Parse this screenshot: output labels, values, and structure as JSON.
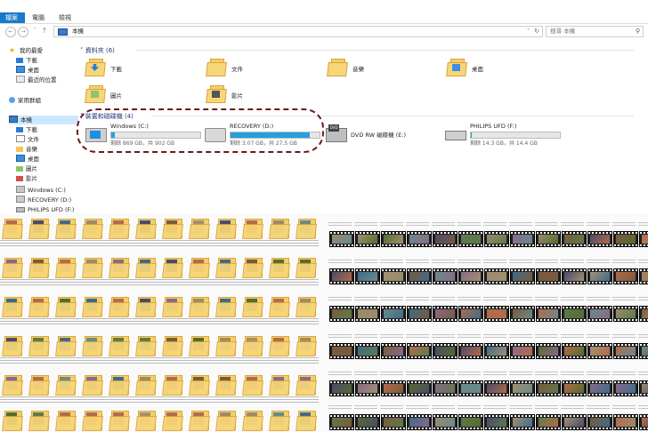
{
  "ribbon": {
    "tabs": [
      "檔案",
      "電腦",
      "檢視"
    ]
  },
  "address": {
    "crumb": "本機",
    "search_placeholder": "搜尋 本機"
  },
  "nav_pane": {
    "favorites_header": "我的最愛",
    "favorites": [
      "下載",
      "桌面",
      "最近的位置"
    ],
    "homegroup": "家用群組",
    "this_pc": "本機",
    "pc_items": [
      "下載",
      "文件",
      "音樂",
      "桌面",
      "圖片",
      "影片",
      "Windows (C:)",
      "RECOVERY (D:)",
      "PHILIPS UFD (F:)"
    ]
  },
  "folders_section": {
    "title": "資料夾 (6)",
    "items": [
      "下載",
      "文件",
      "音樂",
      "桌面",
      "圖片",
      "影片"
    ]
  },
  "drives_section": {
    "title": "裝置和磁碟機 (4)",
    "drives": [
      {
        "name": "Windows (C:)",
        "free_text": "剩餘 869 GB，共 902 GB",
        "used_fraction": 0.04
      },
      {
        "name": "RECOVERY (D:)",
        "free_text": "剩餘 3.07 GB，共 27.5 GB",
        "used_fraction": 0.89
      },
      {
        "name": "DVD RW 磁碟機 (E:)",
        "free_text": "",
        "used_fraction": null
      },
      {
        "name": "PHILIPS UFD (F:)",
        "free_text": "剩餘 14.3 GB，共 14.4 GB",
        "used_fraction": 0.01
      }
    ]
  },
  "colors": {
    "accent": "#1979ca",
    "drive_bar": "#26a0da",
    "folder": "#f5cf67",
    "annotation": "#6b1a1a"
  }
}
